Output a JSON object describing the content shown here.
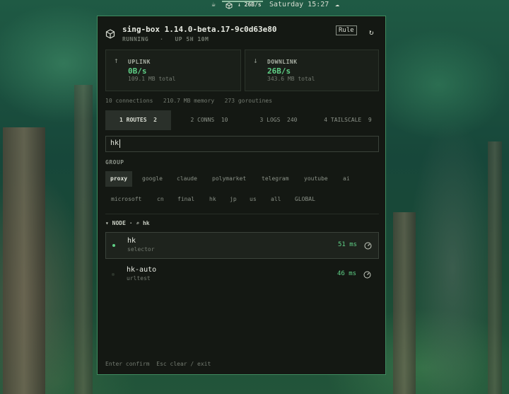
{
  "topbar": {
    "speed": "↓ 26B/s",
    "clock": "Saturday 15:27"
  },
  "panel": {
    "title": "sing-box 1.14.0-beta.17-9c0d63e80",
    "status": "RUNNING",
    "uptime": "UP 5H 10M",
    "mode": "Rule",
    "uplink": {
      "label": "UPLINK",
      "value": "0B/s",
      "total": "109.1 MB total"
    },
    "downlink": {
      "label": "DOWNLINK",
      "value": "26B/s",
      "total": "343.6 MB total"
    },
    "stats": {
      "connections": "10 connections",
      "memory": "210.7 MB memory",
      "goroutines": "273 goroutines"
    },
    "tabs": [
      {
        "label": "1 ROUTES",
        "count": "2"
      },
      {
        "label": "2 CONNS",
        "count": "10"
      },
      {
        "label": "3 LOGS",
        "count": "240"
      },
      {
        "label": "4 TAILSCALE",
        "count": "9"
      }
    ],
    "search_value": "hk",
    "group_label": "GROUP",
    "groups": [
      "proxy",
      "google",
      "claude",
      "polymarket",
      "telegram",
      "youtube",
      "ai",
      "microsoft",
      "cn",
      "final",
      "hk",
      "jp",
      "us",
      "all",
      "GLOBAL"
    ],
    "node_header": "▾ NODE · ⌕ hk",
    "nodes": [
      {
        "name": "hk",
        "type": "selector",
        "latency": "51 ms"
      },
      {
        "name": "hk-auto",
        "type": "urltest",
        "latency": "46 ms"
      }
    ],
    "footer": "Enter confirm  Esc clear / exit"
  }
}
